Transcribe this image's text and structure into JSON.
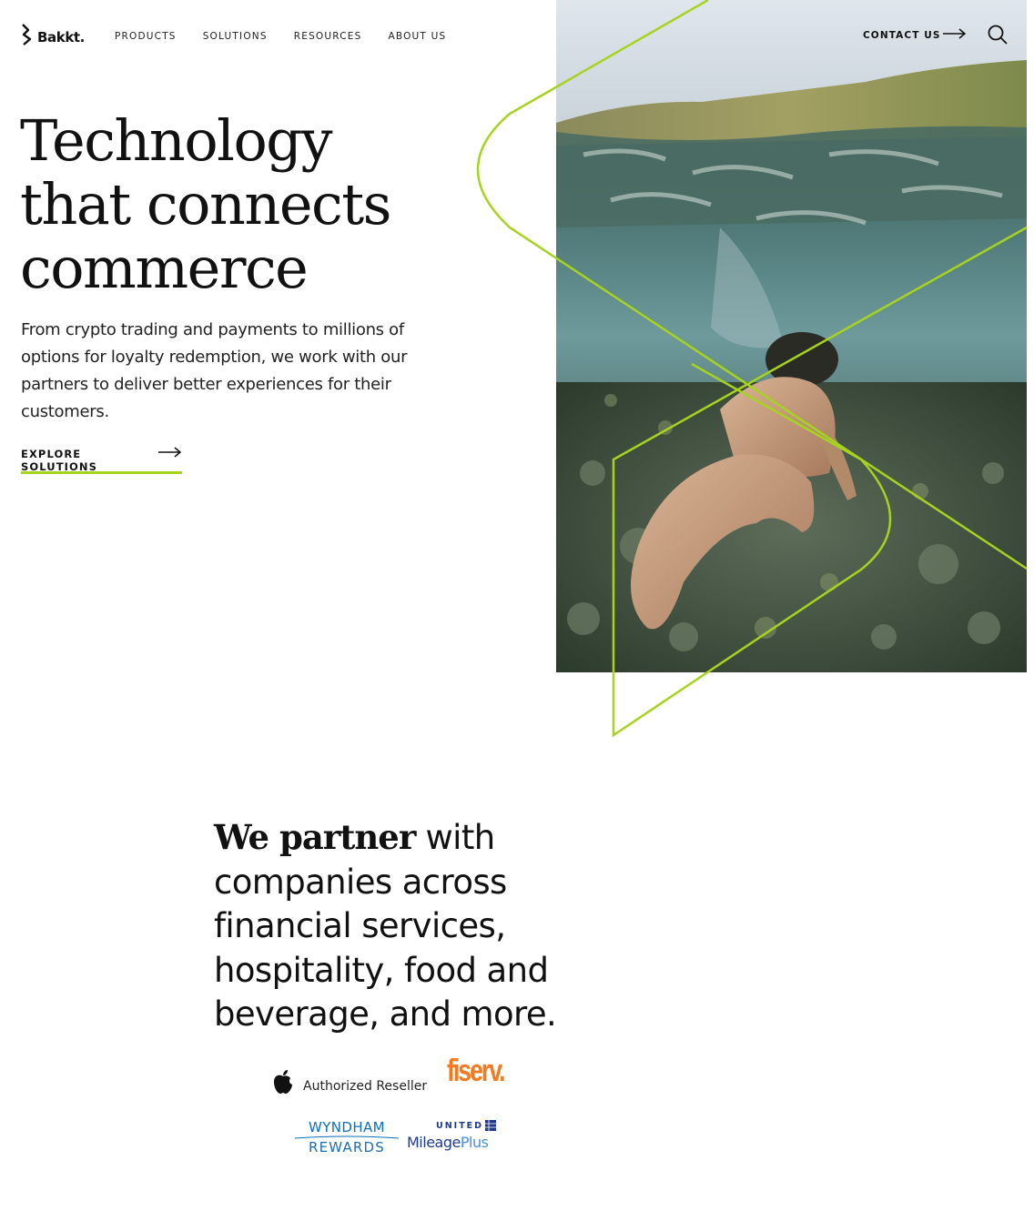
{
  "header": {
    "logo_text": "Bakkt.",
    "nav": [
      {
        "label": "PRODUCTS"
      },
      {
        "label": "SOLUTIONS"
      },
      {
        "label": "RESOURCES"
      },
      {
        "label": "ABOUT US"
      }
    ],
    "contact_label": "CONTACT US"
  },
  "hero": {
    "title_lines": [
      "Technology",
      "that connects",
      "commerce"
    ],
    "subtitle_lines": [
      "From crypto trading and payments to millions of",
      "options for loyalty redemption, we work with our",
      "partners to deliver better experiences for their",
      "customers."
    ],
    "cta_label": "EXPLORE SOLUTIONS"
  },
  "partners": {
    "heading_serif": "We partner",
    "heading_lines": [
      " with",
      "companies across",
      "financial services,",
      "hospitality, food and",
      "beverage, and more."
    ],
    "logos": {
      "apple_label": "Authorized Reseller",
      "fiserv": "fiserv.",
      "wyndham_line1": "WYNDHAM",
      "wyndham_line2": "REWARDS",
      "united_line1": "UNITED",
      "united_mileage": "Mileage",
      "united_plus": "Plus"
    }
  },
  "colors": {
    "accent_green": "#a6d41e",
    "fiserv_orange": "#f47a20",
    "wyndham_blue": "#0e6fb6",
    "united_blue": "#1f3a8a"
  },
  "icons": [
    "bakkt-logo-icon",
    "arrow-right-icon",
    "search-icon",
    "apple-icon",
    "united-globe-icon"
  ]
}
